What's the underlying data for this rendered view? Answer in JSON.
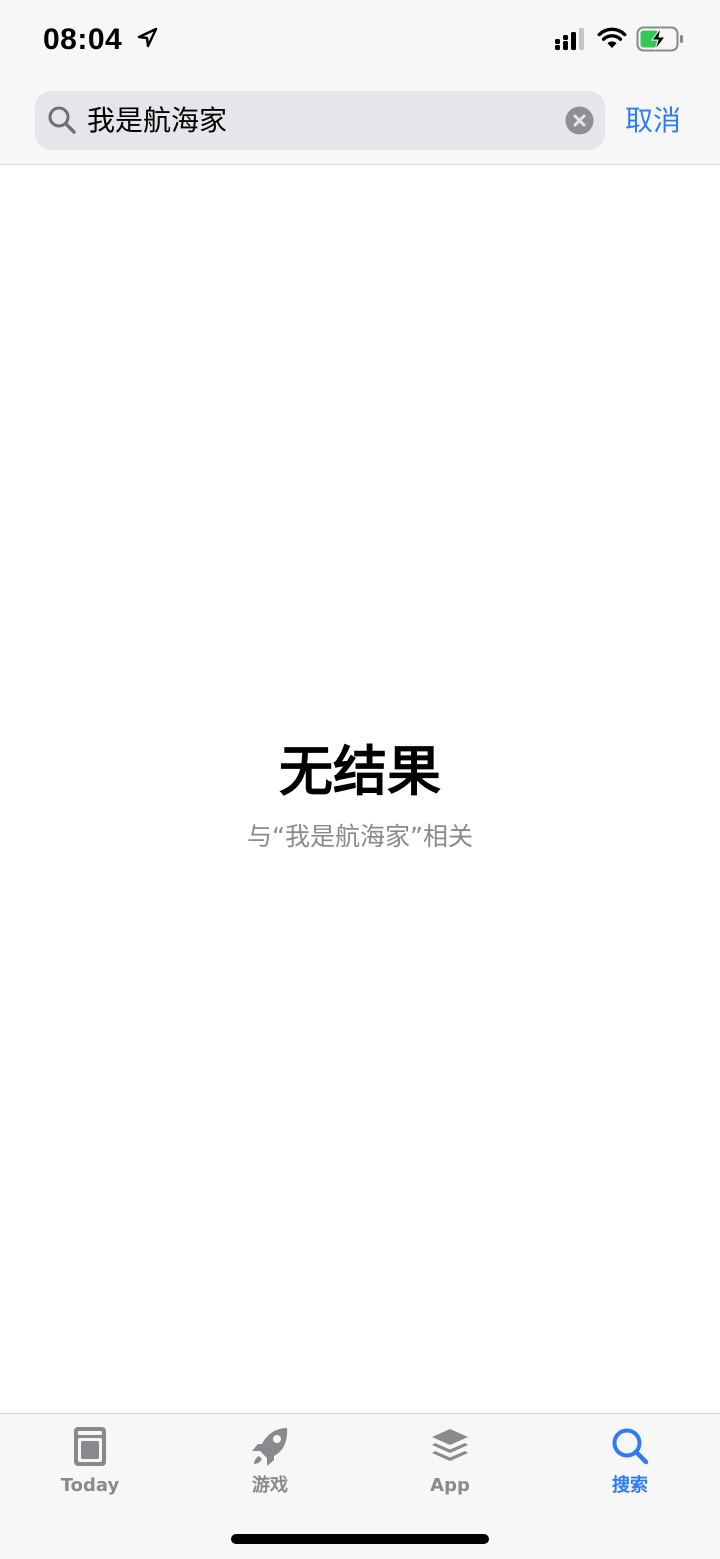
{
  "status_bar": {
    "time": "08:04",
    "icons": [
      "location-arrow-icon",
      "cellular-signal-icon",
      "wifi-icon",
      "battery-charging-icon"
    ]
  },
  "search": {
    "query": "我是航海家",
    "cancel_label": "取消"
  },
  "results": {
    "title": "无结果",
    "subtitle": "与“我是航海家”相关"
  },
  "tab_bar": {
    "active_color": "#2d7cf6",
    "inactive_color": "#8a8a8e",
    "tabs": [
      {
        "label": "Today",
        "icon": "today-icon",
        "active": false
      },
      {
        "label": "游戏",
        "icon": "rocket-icon",
        "active": false
      },
      {
        "label": "App",
        "icon": "app-stack-icon",
        "active": false
      },
      {
        "label": "搜索",
        "icon": "search-icon",
        "active": true
      }
    ]
  }
}
